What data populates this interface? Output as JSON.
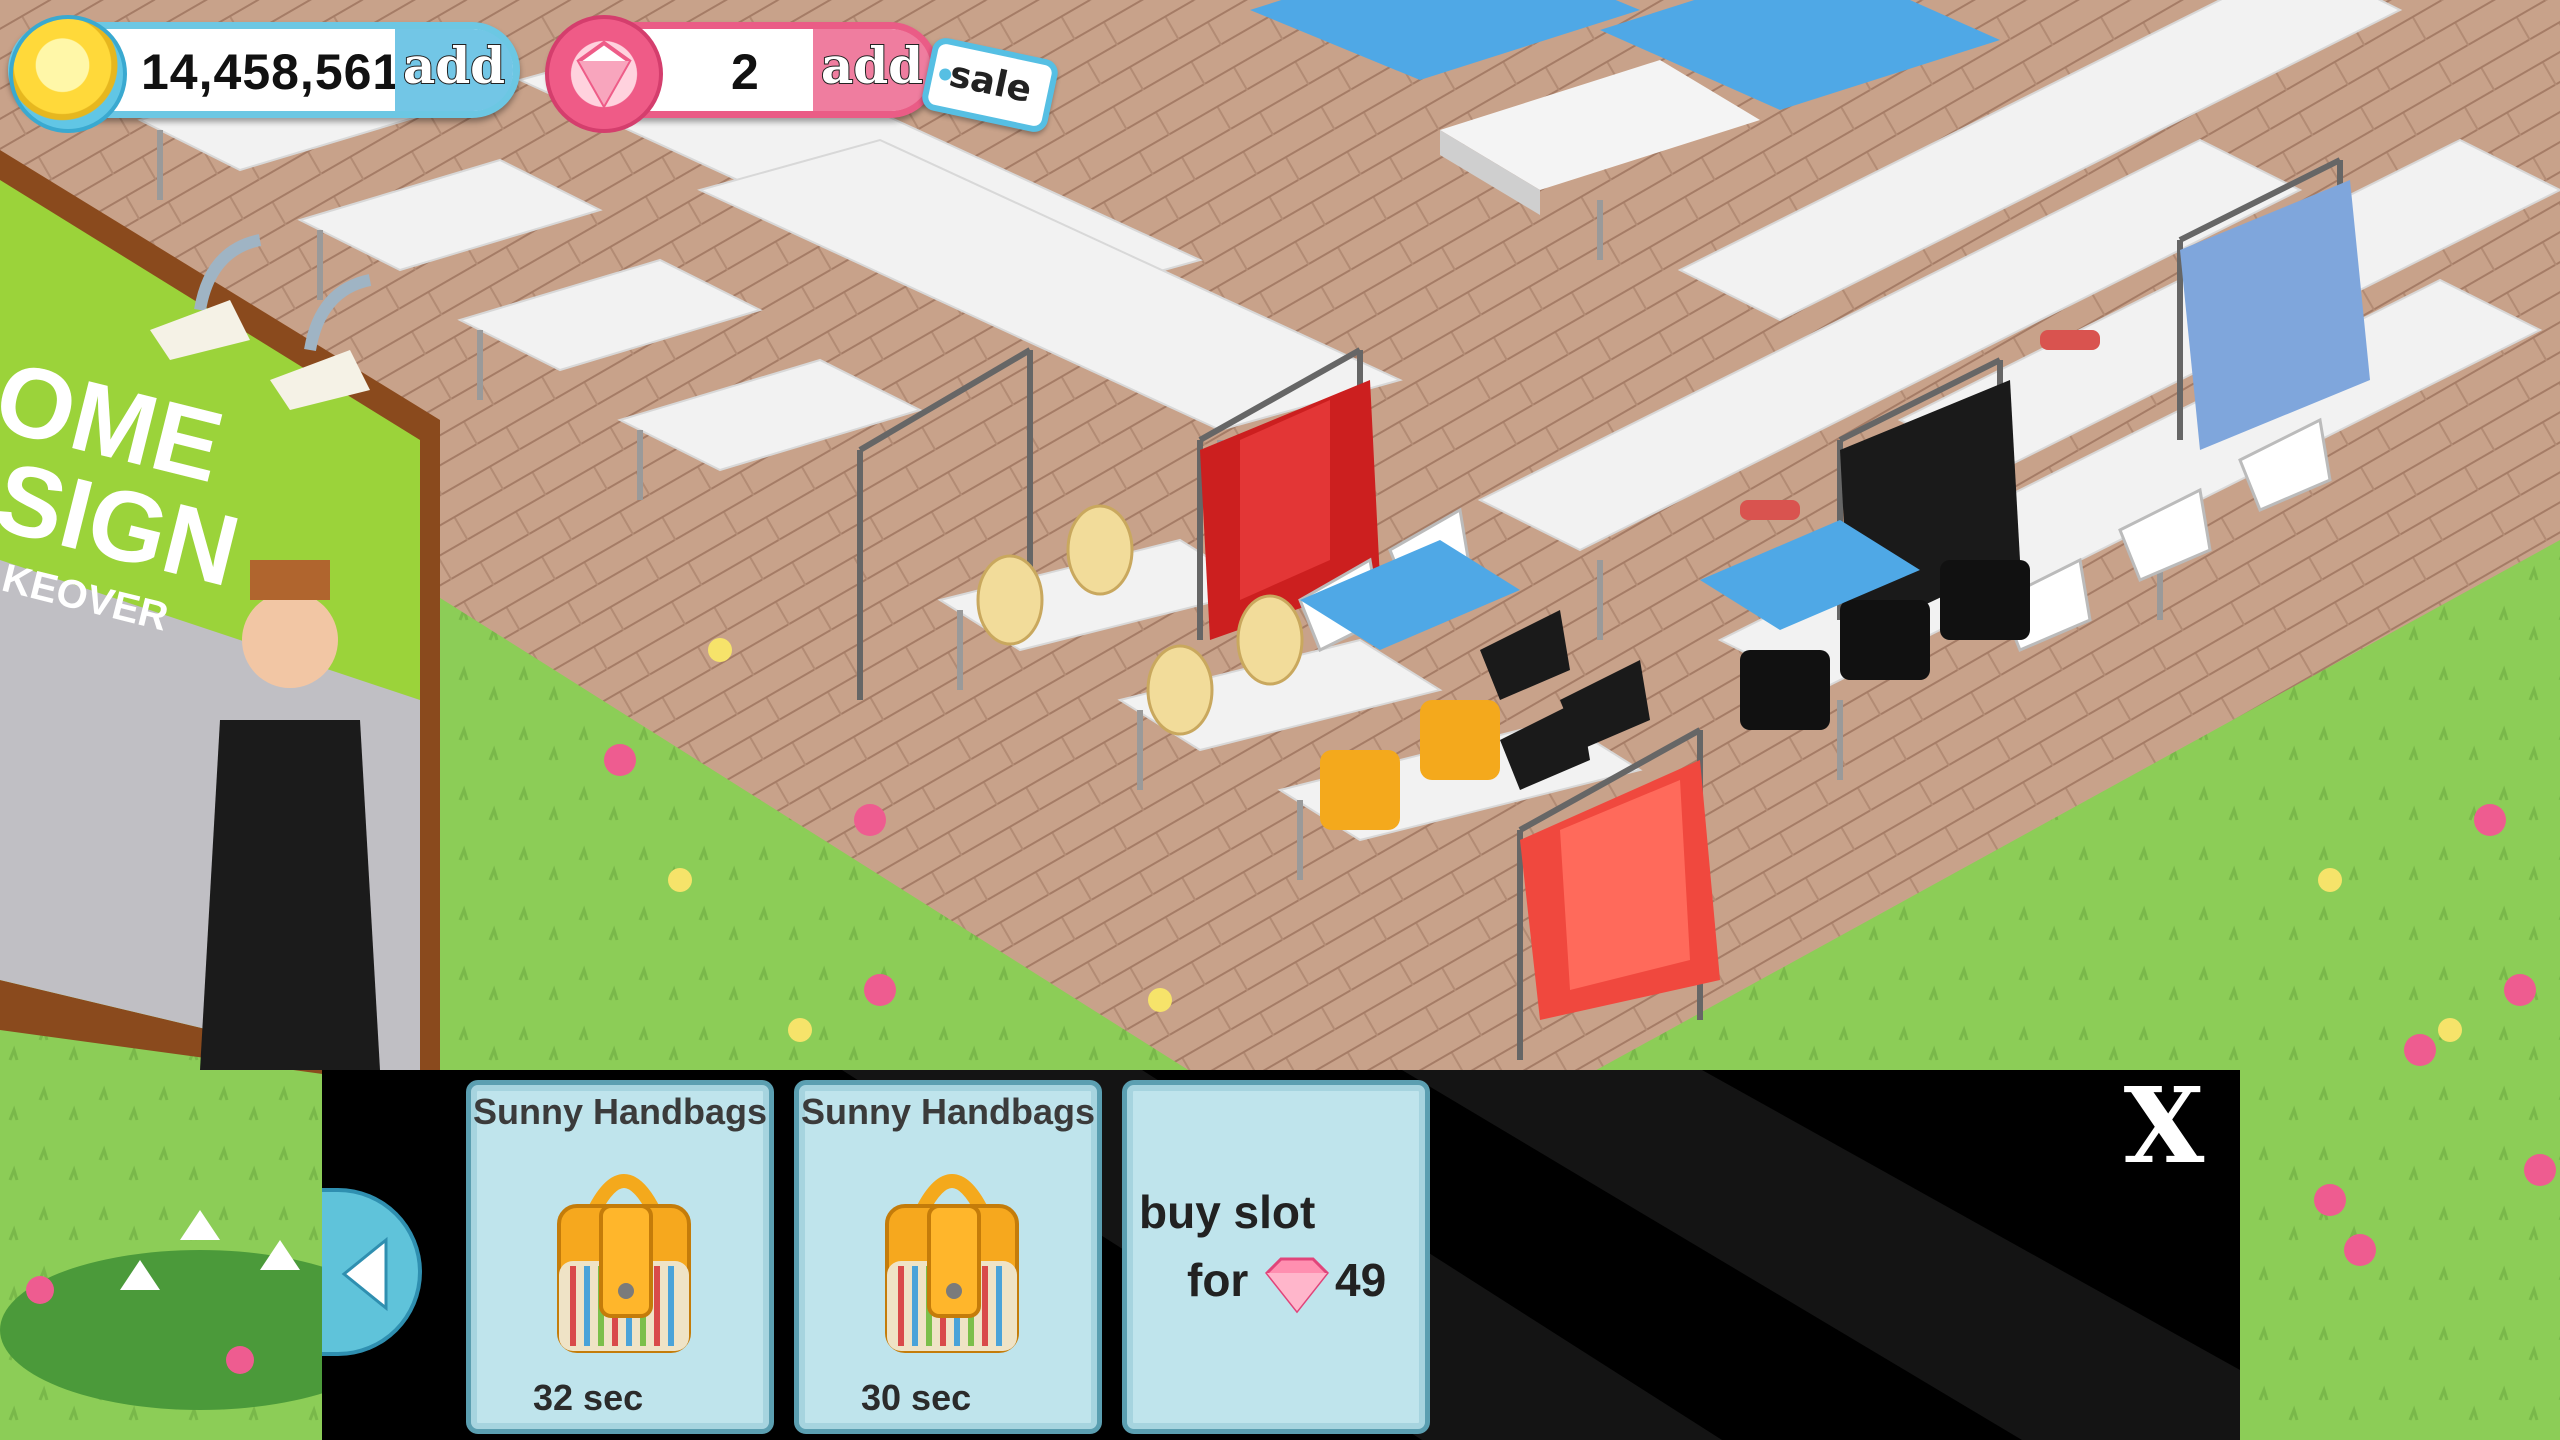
{
  "hud": {
    "coins": {
      "value": "14,458,561",
      "add_label": "add",
      "icon": "coin-icon"
    },
    "gems": {
      "value": "2",
      "add_label": "add",
      "icon": "gem-icon"
    },
    "sale_label": "sale"
  },
  "billboard": {
    "lines": [
      "OME",
      "SIGN",
      "KEOVER"
    ]
  },
  "panel": {
    "slots": [
      {
        "title": "Sunny Handbags",
        "timer": "32 sec",
        "icon": "handbag-icon"
      },
      {
        "title": "Sunny Handbags",
        "timer": "30 sec",
        "icon": "handbag-icon"
      }
    ],
    "buy_slot": {
      "line1": "buy slot",
      "for_label": "for",
      "price": "49",
      "icon": "gem-icon"
    },
    "close_label": "X",
    "back_icon": "left-arrow-icon"
  },
  "colors": {
    "grass": "#8fcf5a",
    "floor": "#c9a38c",
    "coin_ring": "#6cc7e3",
    "gem_ring": "#ea5c86",
    "slot_bg": "#bfe4ec",
    "panel_bg": "#000000"
  }
}
